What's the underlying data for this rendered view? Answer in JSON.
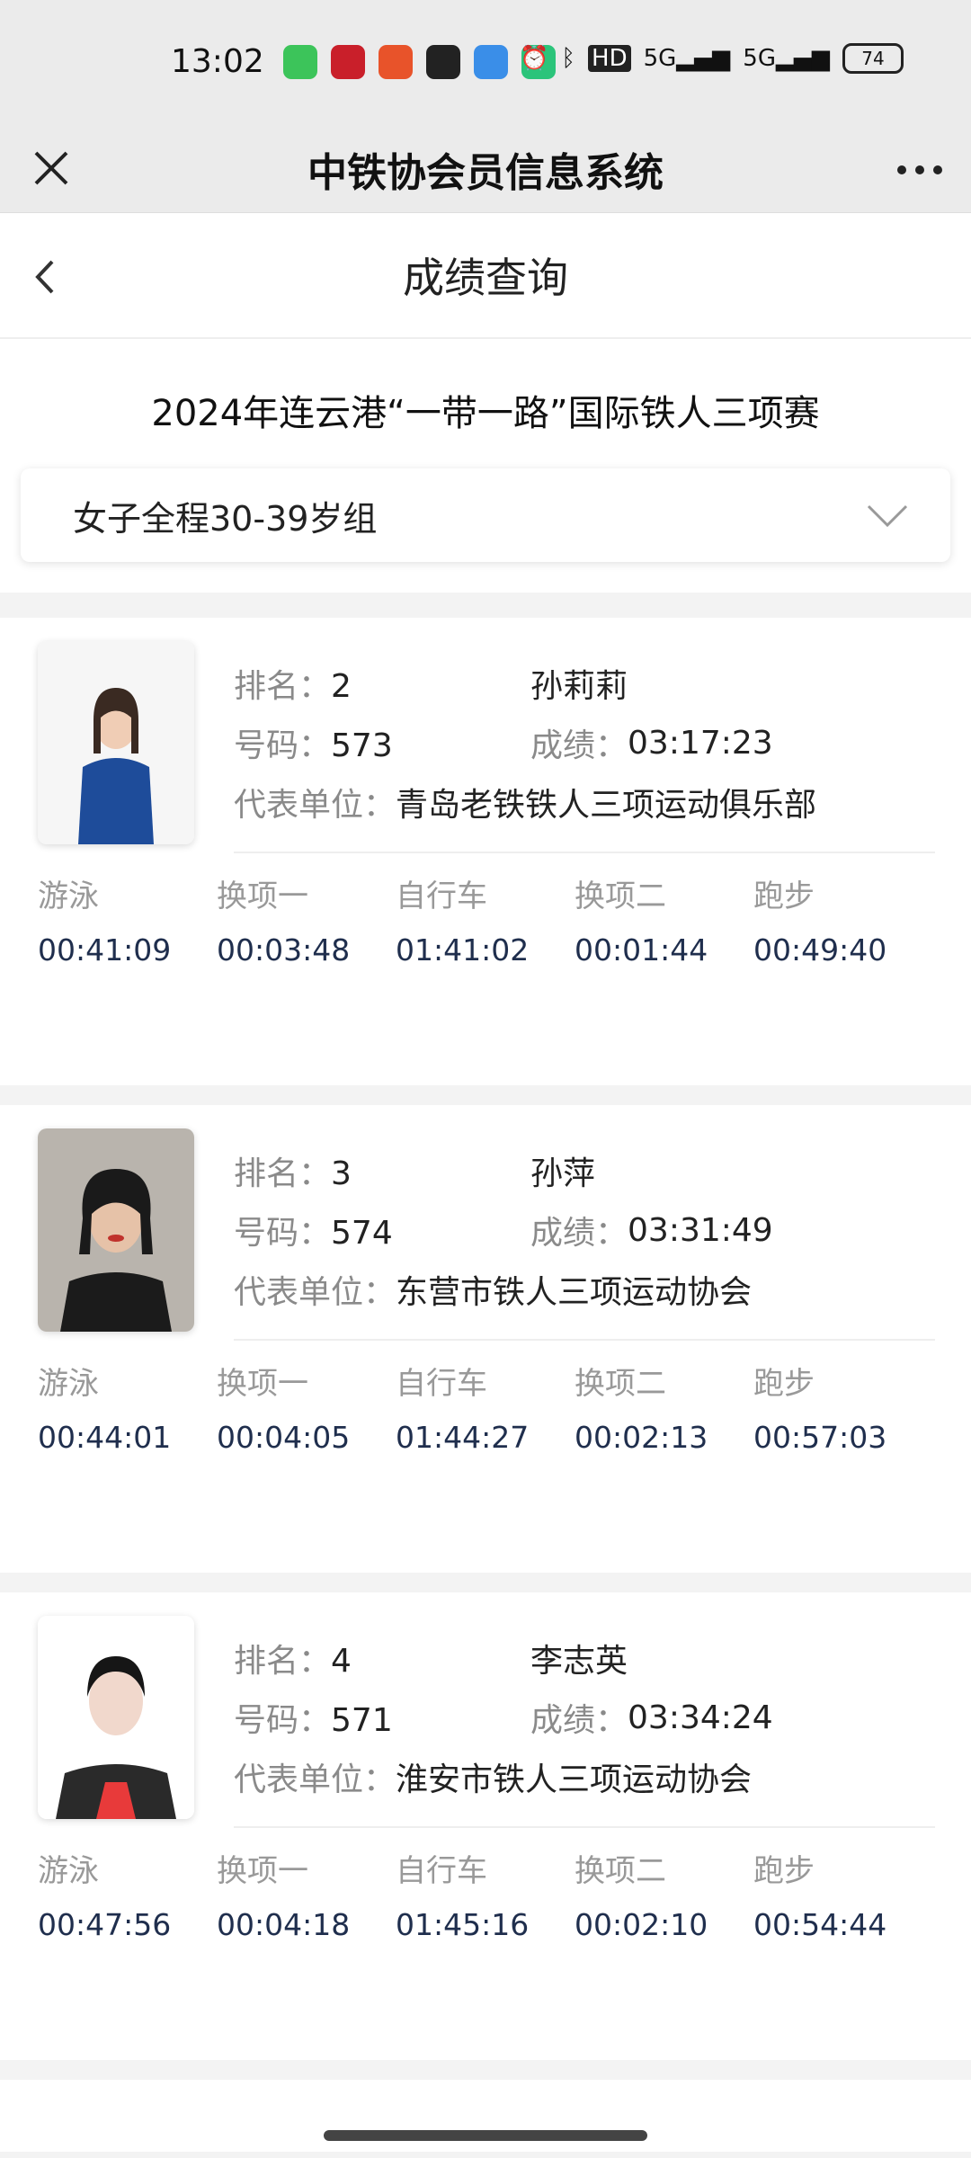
{
  "status_bar": {
    "time": "13:02",
    "battery": "74",
    "hd": "HD",
    "net1": "5G",
    "net2": "5G"
  },
  "wx": {
    "title": "中铁协会员信息系统"
  },
  "page": {
    "title": "成绩查询"
  },
  "event": {
    "title": "2024年连云港“一带一路”国际铁人三项赛"
  },
  "group_select": {
    "value": "女子全程30-39岁组"
  },
  "labels": {
    "rank": "排名：",
    "number": "号码：",
    "score": "成绩：",
    "unit": "代表单位："
  },
  "split_names": [
    "游泳",
    "换项一",
    "自行车",
    "换项二",
    "跑步"
  ],
  "results": [
    {
      "rank": "2",
      "name": "孙莉莉",
      "number": "573",
      "score": "03:17:23",
      "unit": "青岛老铁铁人三项运动俱乐部",
      "splits": [
        "00:41:09",
        "00:03:48",
        "01:41:02",
        "00:01:44",
        "00:49:40"
      ]
    },
    {
      "rank": "3",
      "name": "孙萍",
      "number": "574",
      "score": "03:31:49",
      "unit": "东营市铁人三项运动协会",
      "splits": [
        "00:44:01",
        "00:04:05",
        "01:44:27",
        "00:02:13",
        "00:57:03"
      ]
    },
    {
      "rank": "4",
      "name": "李志英",
      "number": "571",
      "score": "03:34:24",
      "unit": "淮安市铁人三项运动协会",
      "splits": [
        "00:47:56",
        "00:04:18",
        "01:45:16",
        "00:02:10",
        "00:54:44"
      ]
    }
  ],
  "colors": {
    "split_time": "#1f2e4d",
    "label": "#8a8a8a"
  }
}
